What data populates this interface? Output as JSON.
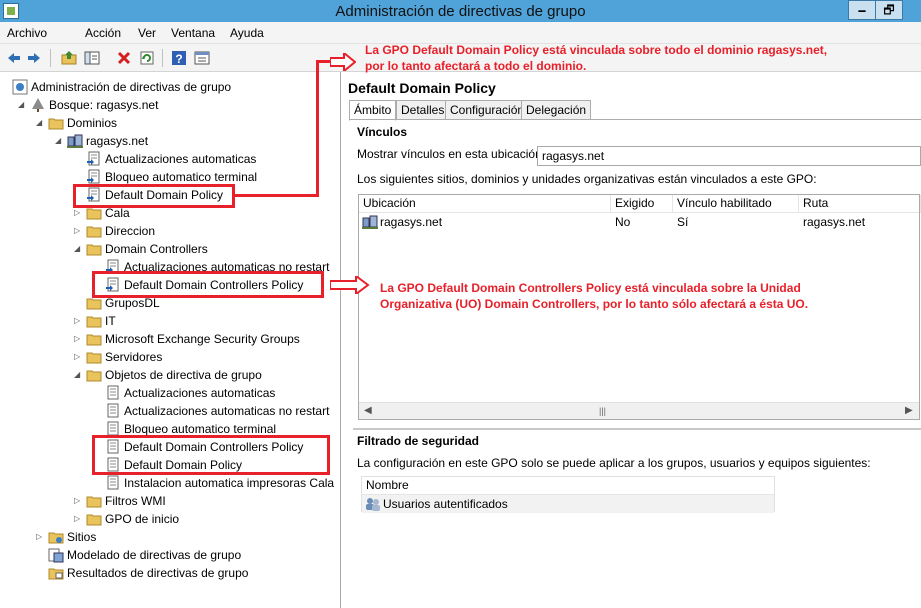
{
  "window": {
    "title": "Administración de directivas de grupo",
    "btn_minimize": "🗕",
    "btn_maximize": "🗗"
  },
  "menu": [
    "Archivo",
    "Acción",
    "Ver",
    "Ventana",
    "Ayuda"
  ],
  "toolbar": [
    {
      "name": "back-arrow-icon"
    },
    {
      "name": "forward-arrow-icon"
    },
    {
      "name": "up-folder-icon"
    },
    {
      "name": "show-hide-tree-icon"
    },
    {
      "name": "delete-icon"
    },
    {
      "name": "refresh-icon"
    },
    {
      "name": "help-icon"
    },
    {
      "name": "properties-icon"
    }
  ],
  "tree": [
    {
      "label": "Administración de directivas de grupo",
      "icon": "gpm-icon",
      "level": 0,
      "expander": "none"
    },
    {
      "label": "Bosque: ragasys.net",
      "icon": "forest-icon",
      "level": 1,
      "expander": "open"
    },
    {
      "label": "Dominios",
      "icon": "folder-icon",
      "level": 2,
      "expander": "open"
    },
    {
      "label": "ragasys.net",
      "icon": "domain-icon",
      "level": 3,
      "expander": "open"
    },
    {
      "label": "Actualizaciones automaticas",
      "icon": "gpo-link-icon",
      "level": 4,
      "expander": "none"
    },
    {
      "label": "Bloqueo automatico terminal",
      "icon": "gpo-link-icon",
      "level": 4,
      "expander": "none"
    },
    {
      "label": "Default Domain Policy",
      "icon": "gpo-link-icon",
      "level": 4,
      "expander": "none",
      "selected": true
    },
    {
      "label": "Cala",
      "icon": "folder-icon",
      "level": 4,
      "expander": "closed"
    },
    {
      "label": "Direccion",
      "icon": "folder-icon",
      "level": 4,
      "expander": "closed"
    },
    {
      "label": "Domain Controllers",
      "icon": "folder-icon",
      "level": 4,
      "expander": "open"
    },
    {
      "label": "Actualizaciones automaticas no restart",
      "icon": "gpo-link-icon",
      "level": 5,
      "expander": "none"
    },
    {
      "label": "Default Domain Controllers Policy",
      "icon": "gpo-link-icon",
      "level": 5,
      "expander": "none"
    },
    {
      "label": "GruposDL",
      "icon": "folder-icon",
      "level": 4,
      "expander": "none"
    },
    {
      "label": "IT",
      "icon": "folder-icon",
      "level": 4,
      "expander": "closed"
    },
    {
      "label": "Microsoft Exchange Security Groups",
      "icon": "folder-icon",
      "level": 4,
      "expander": "closed"
    },
    {
      "label": "Servidores",
      "icon": "folder-icon",
      "level": 4,
      "expander": "closed"
    },
    {
      "label": "Objetos de directiva de grupo",
      "icon": "folder-icon",
      "level": 4,
      "expander": "open"
    },
    {
      "label": "Actualizaciones automaticas",
      "icon": "gpo-icon",
      "level": 5,
      "expander": "none"
    },
    {
      "label": "Actualizaciones automaticas no restart",
      "icon": "gpo-icon",
      "level": 5,
      "expander": "none"
    },
    {
      "label": "Bloqueo automatico terminal",
      "icon": "gpo-icon",
      "level": 5,
      "expander": "none"
    },
    {
      "label": "Default Domain Controllers Policy",
      "icon": "gpo-icon",
      "level": 5,
      "expander": "none"
    },
    {
      "label": "Default Domain Policy",
      "icon": "gpo-icon",
      "level": 5,
      "expander": "none"
    },
    {
      "label": "Instalacion automatica impresoras Cala",
      "icon": "gpo-icon",
      "level": 5,
      "expander": "none"
    },
    {
      "label": "Filtros WMI",
      "icon": "folder-icon",
      "level": 4,
      "expander": "closed"
    },
    {
      "label": "GPO de inicio",
      "icon": "folder-icon",
      "level": 4,
      "expander": "closed"
    },
    {
      "label": "Sitios",
      "icon": "sites-icon",
      "level": 2,
      "expander": "closed"
    },
    {
      "label": "Modelado de directivas de grupo",
      "icon": "modeling-icon",
      "level": 2,
      "expander": "none"
    },
    {
      "label": "Resultados de directivas de grupo",
      "icon": "results-icon",
      "level": 2,
      "expander": "none"
    }
  ],
  "details": {
    "title": "Default Domain Policy",
    "tabs": [
      "Ámbito",
      "Detalles",
      "Configuración",
      "Delegación"
    ],
    "links_heading": "Vínculos",
    "location_label": "Mostrar vínculos en esta ubicación:",
    "location_value": "ragasys.net",
    "links_desc": "Los siguientes sitios, dominios y unidades organizativas están vinculados a este GPO:",
    "links_columns": [
      "Ubicación",
      "Exigido",
      "Vínculo habilitado",
      "Ruta"
    ],
    "links_rows": [
      {
        "ubicacion": "ragasys.net",
        "exigido": "No",
        "vinculo": "Sí",
        "ruta": "ragasys.net"
      }
    ],
    "security_heading": "Filtrado de seguridad",
    "security_desc": "La configuración en este GPO solo se puede aplicar a los grupos, usuarios y equipos siguientes:",
    "security_column": "Nombre",
    "security_rows": [
      "Usuarios autentificados"
    ]
  },
  "annotations": {
    "top_line1": "La GPO Default Domain Policy está vinculada sobre todo el dominio ragasys.net,",
    "top_line2": "por lo tanto afectará a todo el dominio.",
    "mid_line1": "La GPO Default Domain Controllers Policy está vinculada sobre la Unidad",
    "mid_line2": "Organizativa (UO) Domain Controllers, por lo tanto sólo afectará a ésta UO.",
    "color": "#e8202a"
  }
}
